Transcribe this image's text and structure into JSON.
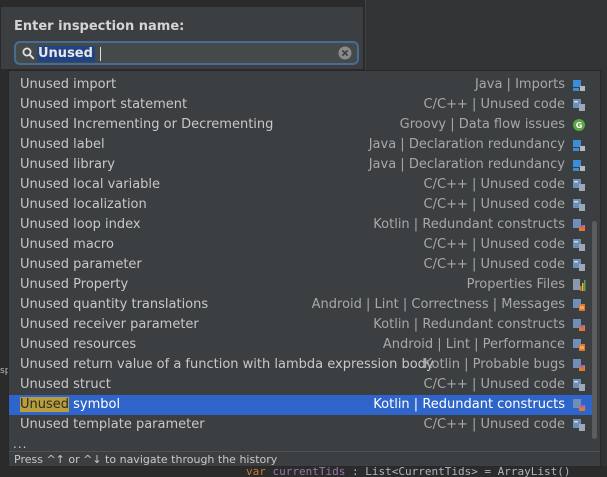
{
  "header": {
    "title": "Enter inspection name:",
    "search": {
      "value": "Unused"
    }
  },
  "items": [
    {
      "name": "Unused import",
      "category": "Java | Imports",
      "icon": "java-icon"
    },
    {
      "name": "Unused import statement",
      "category": "C/C++ | Unused code",
      "icon": "cpp-icon"
    },
    {
      "name": "Unused Incrementing or Decrementing",
      "category": "Groovy | Data flow issues",
      "icon": "groovy-icon"
    },
    {
      "name": "Unused label",
      "category": "Java | Declaration redundancy",
      "icon": "java-icon"
    },
    {
      "name": "Unused library",
      "category": "Java | Declaration redundancy",
      "icon": "java-icon"
    },
    {
      "name": "Unused local variable",
      "category": "C/C++ | Unused code",
      "icon": "cpp-icon"
    },
    {
      "name": "Unused localization",
      "category": "C/C++ | Unused code",
      "icon": "cpp-icon"
    },
    {
      "name": "Unused loop index",
      "category": "Kotlin | Redundant constructs",
      "icon": "kotlin-icon"
    },
    {
      "name": "Unused macro",
      "category": "C/C++ | Unused code",
      "icon": "cpp-icon"
    },
    {
      "name": "Unused parameter",
      "category": "C/C++ | Unused code",
      "icon": "cpp-icon"
    },
    {
      "name": "Unused Property",
      "category": "Properties Files",
      "icon": "properties-icon"
    },
    {
      "name": "Unused quantity translations",
      "category": "Android | Lint | Correctness | Messages",
      "icon": "android-icon"
    },
    {
      "name": "Unused receiver parameter",
      "category": "Kotlin | Redundant constructs",
      "icon": "kotlin-icon"
    },
    {
      "name": "Unused resources",
      "category": "Android | Lint | Performance",
      "icon": "android-icon"
    },
    {
      "name": "Unused return value of a function with lambda expression body",
      "category": "Kotlin | Probable bugs",
      "icon": "kotlin-icon"
    },
    {
      "name": "Unused struct",
      "category": "C/C++ | Unused code",
      "icon": "cpp-icon"
    },
    {
      "name": "Unused symbol",
      "category": "Kotlin | Redundant constructs",
      "icon": "kotlin-icon",
      "selected": true
    },
    {
      "name": "Unused template parameter",
      "category": "C/C++ | Unused code",
      "icon": "cpp-icon"
    }
  ],
  "more_indicator": "...",
  "footer": {
    "hint": "Press ^↑ or ^↓ to navigate through the history"
  },
  "background": {
    "code_line": [
      {
        "text": "var ",
        "kind": "kw"
      },
      {
        "text": "currentTids",
        "kind": "nm"
      },
      {
        "text": " : List<CurrentTids> = ArrayList()",
        "kind": "plain"
      }
    ],
    "left_fragment": "sp"
  },
  "colors": {
    "selection": "#2f65ca",
    "match_highlight": "#b89d3a",
    "search_border": "#466d94",
    "popup_bg": "#3c3f41"
  }
}
